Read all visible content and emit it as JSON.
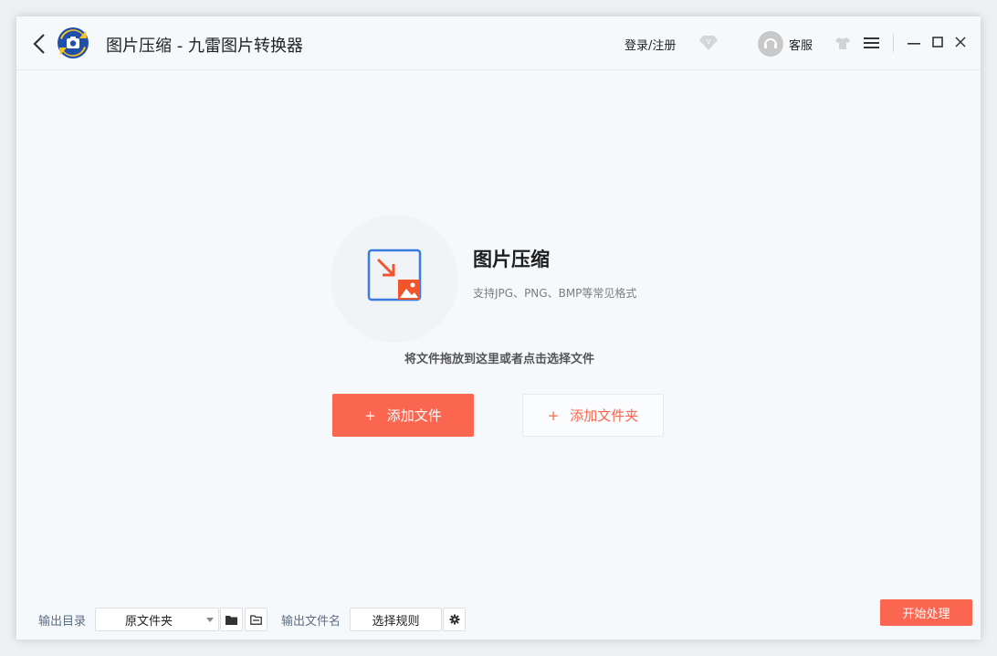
{
  "titlebar": {
    "title": "图片压缩 - 九雷图片转换器",
    "login_label": "登录/注册",
    "support_label": "客服",
    "icons": [
      "back-arrow-icon",
      "app-logo",
      "vip-diamond-icon",
      "headset-icon",
      "skin-shirt-icon",
      "menu-icon",
      "minimize-icon",
      "maximize-icon",
      "close-icon"
    ]
  },
  "main": {
    "feature_title": "图片压缩",
    "feature_subtitle": "支持JPG、PNG、BMP等常见格式",
    "drop_hint": "将文件拖放到这里或者点击选择文件",
    "add_file_label": "添加文件",
    "add_folder_label": "添加文件夹",
    "plus_symbol": "+"
  },
  "bottom": {
    "output_dir_label": "输出目录",
    "output_dir_value": "原文件夹",
    "output_name_label": "输出文件名",
    "rule_button_label": "选择规则",
    "start_button_label": "开始处理"
  },
  "colors": {
    "accent": "#fb6650",
    "icon_blue": "#3a7be0",
    "background": "#f6f9fb"
  }
}
